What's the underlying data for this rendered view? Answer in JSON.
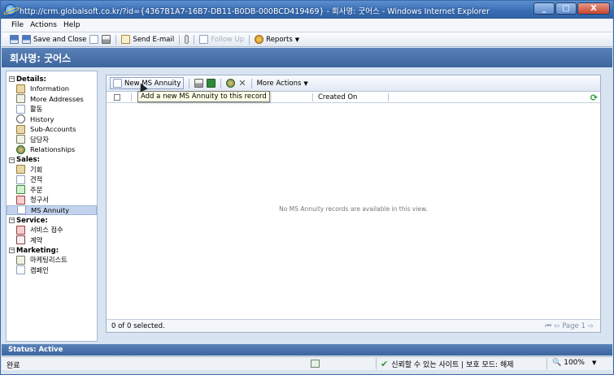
{
  "window": {
    "title": "http://crm.globalsoft.co.kr/?id={4367B1A7-16B7-DB11-B0DB-000BCD419469} - 회사명: 굿어스 - Windows Internet Explorer",
    "minimize": "_",
    "maximize": "□",
    "close": "X"
  },
  "menu": {
    "items": [
      "File",
      "Actions",
      "Help"
    ]
  },
  "toolbar": {
    "save_close": "Save and Close",
    "send_email": "Send E-mail",
    "follow_up": "Follow Up",
    "reports": "Reports"
  },
  "header": {
    "title": "회사명: 굿어스"
  },
  "nav": {
    "details_label": "Details:",
    "details": [
      "Information",
      "More Addresses",
      "활동",
      "History",
      "Sub-Accounts",
      "담당자",
      "Relationships"
    ],
    "sales_label": "Sales:",
    "sales": [
      "기회",
      "견적",
      "주문",
      "청구서",
      "MS Annuity"
    ],
    "service_label": "Service:",
    "service": [
      "서비스 접수",
      "계약"
    ],
    "marketing_label": "Marketing:",
    "marketing": [
      "마케팅리스트",
      "캠페인"
    ],
    "collapse_glyph": "−"
  },
  "grid": {
    "new_button": "New MS Annuity",
    "more_actions": "More Actions",
    "tooltip": "Add a new MS Annuity to this record",
    "col_created_on": "Created On",
    "empty_message": "No MS Annuity records are available in this view.",
    "selected_count": "0 of 0 selected.",
    "page_label": "Page 1"
  },
  "status": {
    "label": "Status: Active"
  },
  "iestatus": {
    "done": "완료",
    "zone": "신뢰할 수 있는 사이트 | 보호 모드: 해제",
    "zoom": "100%"
  },
  "colors": {
    "title_bar": "#3a6fb5",
    "header_band": "#4a72aa",
    "nav_active": "#c3d3ee",
    "tooltip_bg": "#ffffe8"
  }
}
